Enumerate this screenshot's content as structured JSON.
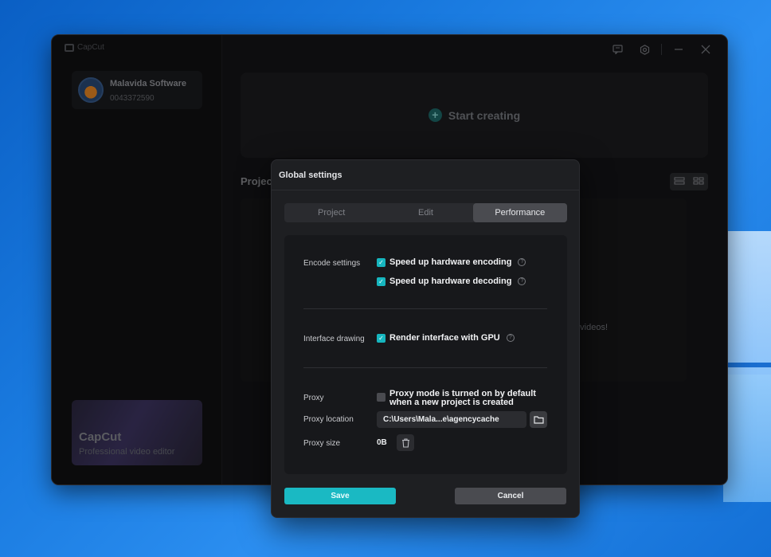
{
  "app": {
    "brand": "CapCut",
    "user": {
      "name": "Malavida Software",
      "id": "0043372590"
    },
    "promo": {
      "title": "CapCut",
      "subtitle": "Professional video editor"
    },
    "start_label": "Start creating",
    "projects_label": "Projects",
    "empty_hint": "n videos!"
  },
  "dialog": {
    "title": "Global settings",
    "tabs": [
      {
        "label": "Project",
        "active": false
      },
      {
        "label": "Edit",
        "active": false
      },
      {
        "label": "Performance",
        "active": true
      }
    ],
    "encode": {
      "label": "Encode settings",
      "options": [
        {
          "label": "Speed up hardware encoding",
          "checked": true
        },
        {
          "label": "Speed up hardware decoding",
          "checked": true
        }
      ]
    },
    "interface": {
      "label": "Interface drawing",
      "option": {
        "label": "Render interface with GPU",
        "checked": true
      }
    },
    "proxy": {
      "label": "Proxy",
      "option_line1": "Proxy mode is turned on by default",
      "option_line2": "when a new project is created",
      "checked": false,
      "location_label": "Proxy location",
      "location_value": "C:\\Users\\Mala...e\\agencycache",
      "size_label": "Proxy size",
      "size_value": "0B"
    },
    "save_label": "Save",
    "cancel_label": "Cancel"
  },
  "colors": {
    "accent": "#1ab9c3",
    "dialog_bg": "#1e1f22",
    "app_bg": "#151517"
  }
}
